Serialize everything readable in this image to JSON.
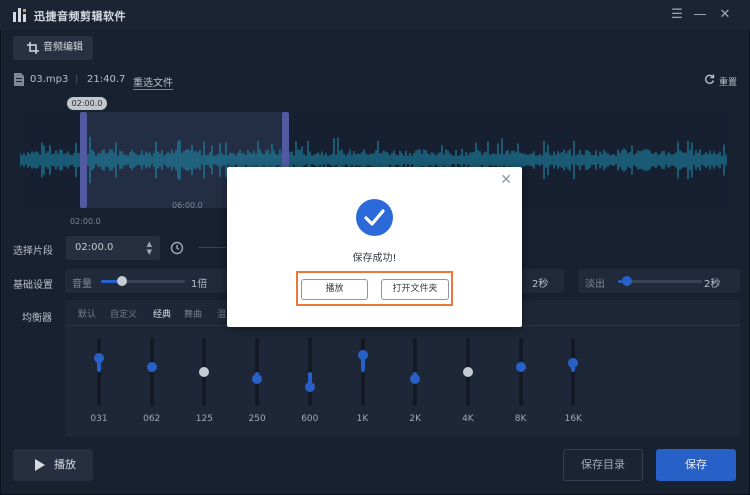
{
  "app": {
    "title": "迅捷音频剪辑软件",
    "window_buttons": {
      "menu": "☰",
      "minimize": "—",
      "close": "✕"
    }
  },
  "tab": {
    "label": "音频编辑",
    "icon": "crop-icon"
  },
  "file": {
    "name": "03.mp3",
    "duration": "21:40.7",
    "reselect_label": "重选文件",
    "reset_label": "重置"
  },
  "waveform": {
    "start_time_bubble": "02:00.0",
    "tick_start": "02:00.0",
    "tick_mid": "06:00.0",
    "selection_fraction": [
      0.09,
      0.38
    ]
  },
  "segment": {
    "label": "选择片段",
    "start_value": "02:00.0"
  },
  "basic_settings": {
    "label": "基础设置",
    "volume_label": "音量",
    "volume_value": "1倍",
    "volume_level": 0.25,
    "fade_in_value": "2秒",
    "fade_out_label": "淡出",
    "fade_out_value": "2秒",
    "fade_out_level": 0.05
  },
  "equalizer": {
    "label": "均衡器",
    "tabs": [
      "默认",
      "自定义",
      "经典",
      "舞曲",
      "温"
    ],
    "active_tab": 2,
    "bands": [
      {
        "label": "031",
        "level": 0.7
      },
      {
        "label": "062",
        "level": 0.58
      },
      {
        "label": "125",
        "level": 0.5
      },
      {
        "label": "250",
        "level": 0.4
      },
      {
        "label": "600",
        "level": 0.28
      },
      {
        "label": "1K",
        "level": 0.75
      },
      {
        "label": "2K",
        "level": 0.4
      },
      {
        "label": "4K",
        "level": 0.5
      },
      {
        "label": "8K",
        "level": 0.58
      },
      {
        "label": "16K",
        "level": 0.63
      }
    ]
  },
  "buttons": {
    "play": "播放",
    "save_dir": "保存目录",
    "save": "保存"
  },
  "dialog": {
    "message": "保存成功!",
    "play_label": "播放",
    "open_folder_label": "打开文件夹",
    "close_icon": "close-icon",
    "highlight_color": "#e8793b"
  },
  "colors": {
    "accent": "#2b6ad8",
    "background": "#1b2433",
    "waveform": "#1fa2c9",
    "handle": "#5a63b0"
  }
}
